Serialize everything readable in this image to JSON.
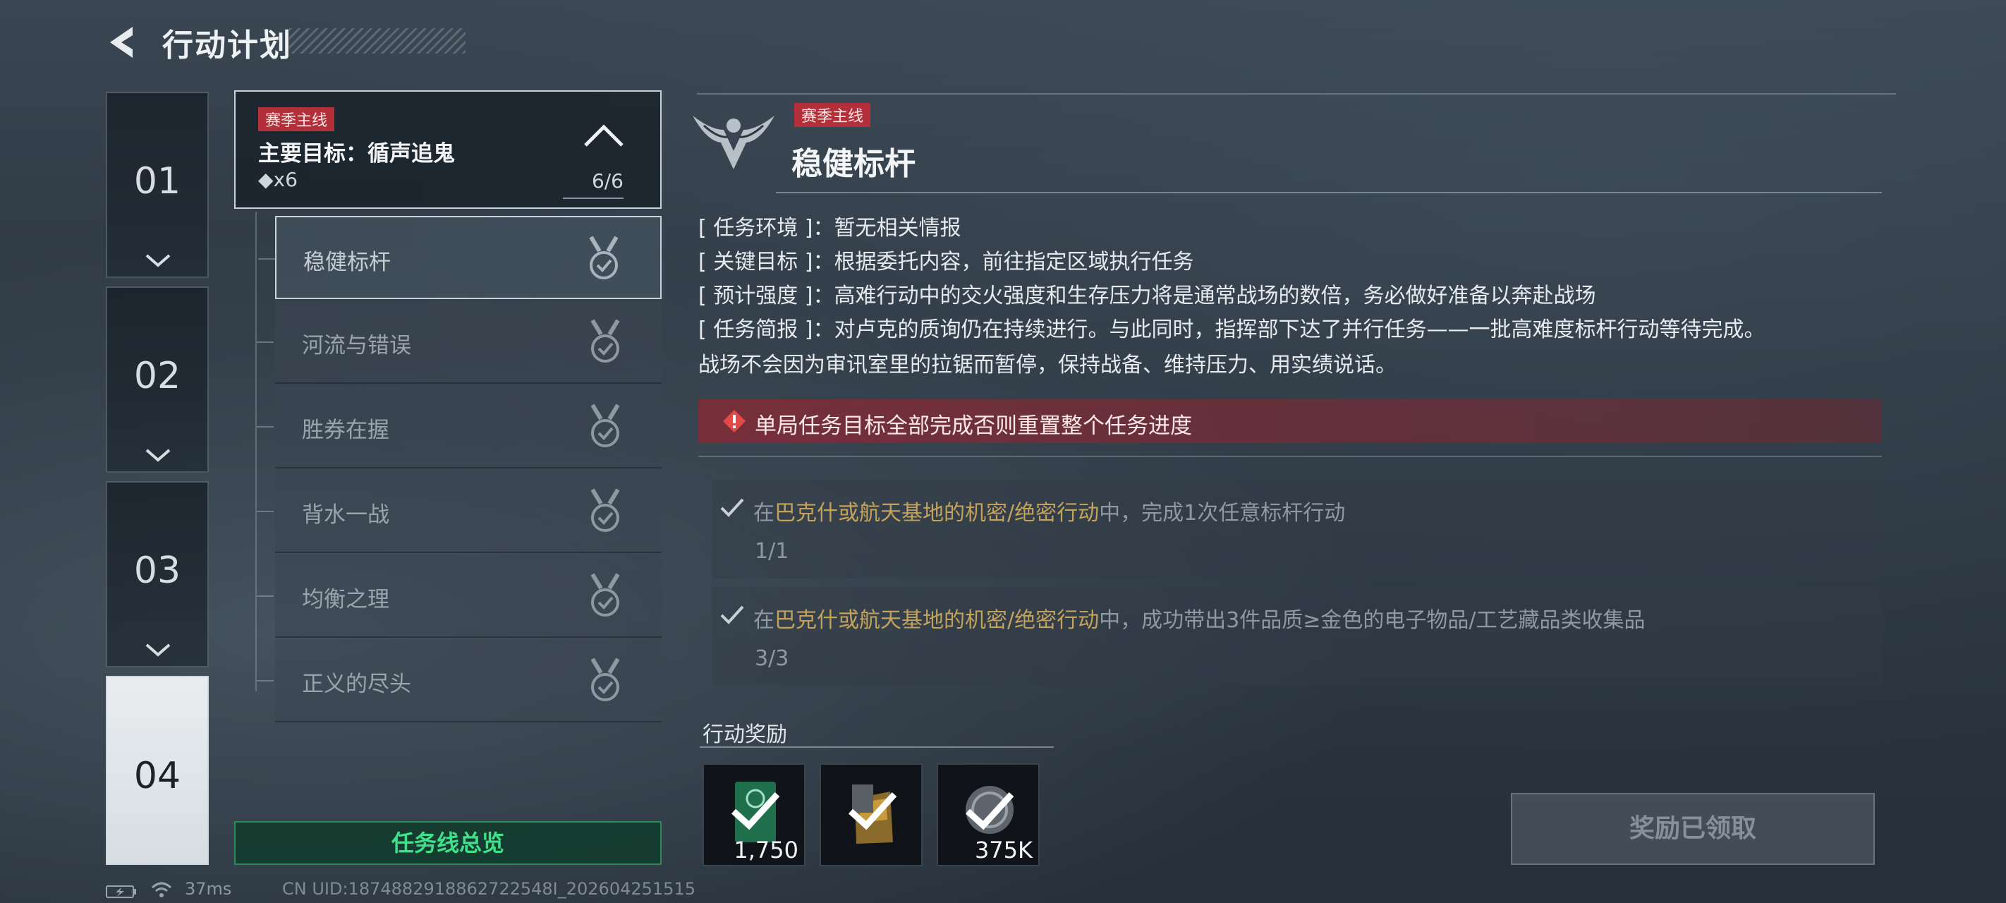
{
  "header": {
    "title": "行动计划"
  },
  "chapters": [
    {
      "label": "01"
    },
    {
      "label": "02"
    },
    {
      "label": "03"
    },
    {
      "label": "04"
    }
  ],
  "mission": {
    "tag": "赛季主线",
    "title": "主要目标：循声追鬼",
    "count": "◆x6",
    "progress": "6/6",
    "tasks": [
      {
        "label": "稳健标杆"
      },
      {
        "label": "河流与错误"
      },
      {
        "label": "胜券在握"
      },
      {
        "label": "背水一战"
      },
      {
        "label": "均衡之理"
      },
      {
        "label": "正义的尽头"
      }
    ],
    "overview_button": "任务线总览"
  },
  "detail": {
    "tag": "赛季主线",
    "title": "稳健标杆",
    "info": {
      "env": "[ 任务环境 ]：暂无相关情报",
      "goal": "[ 关键目标 ]：根据委托内容，前往指定区域执行任务",
      "intensity": "[ 预计强度 ]：高难行动中的交火强度和生存压力将是通常战场的数倍，务必做好准备以奔赴战场",
      "brief": "[ 任务简报 ]：对卢克的质询仍在持续进行。与此同时，指挥部下达了并行任务——一批高难度标杆行动等待完成。",
      "brief2": "战场不会因为审讯室里的拉锯而暂停，保持战备、维持压力、用实绩说话。"
    },
    "warning": "单局任务目标全部完成否则重置整个任务进度",
    "objectives": [
      {
        "prefix": "在",
        "highlight": "巴克什或航天基地的机密/绝密行动",
        "suffix": "中，完成1次任意标杆行动",
        "progress": "1/1"
      },
      {
        "prefix": "在",
        "highlight": "巴克什或航天基地的机密/绝密行动",
        "suffix": "中，成功带出3件品质≥金色的电子物品/工艺藏品类收集品",
        "progress": "3/3"
      }
    ],
    "rewards_title": "行动奖励",
    "rewards": [
      {
        "icon": "green-card-icon",
        "qty": "1,750"
      },
      {
        "icon": "gold-crate-icon",
        "qty": ""
      },
      {
        "icon": "silver-coin-icon",
        "qty": "375K"
      }
    ],
    "claimed_button": "奖励已领取"
  },
  "status": {
    "ping": "37ms",
    "uid": "CN UID:1874882918862722548I_202604251515"
  },
  "colors": {
    "accent_green": "#3fe08a",
    "tag_red": "#b3303a",
    "highlight_gold": "#c3a35a"
  }
}
